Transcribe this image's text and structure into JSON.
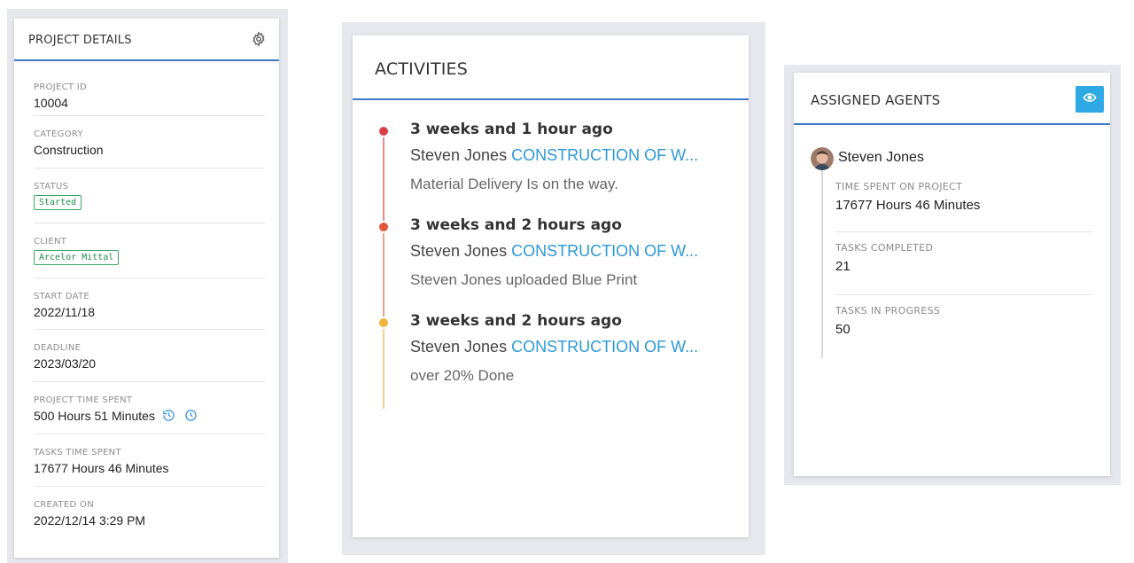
{
  "project_details": {
    "title": "PROJECT DETAILS",
    "fields": [
      {
        "label": "PROJECT ID",
        "value": "10004"
      },
      {
        "label": "CATEGORY",
        "value": "Construction"
      },
      {
        "label": "STATUS",
        "badge": "Started"
      },
      {
        "label": "CLIENT",
        "badge": "Arcelor Mittal"
      },
      {
        "label": "START DATE",
        "value": "2022/11/18"
      },
      {
        "label": "DEADLINE",
        "value": "2023/03/20"
      },
      {
        "label": "PROJECT TIME SPENT",
        "value": "500 Hours 51 Minutes"
      },
      {
        "label": "TASKS TIME SPENT",
        "value": "17677 Hours 46 Minutes"
      },
      {
        "label": "CREATED ON",
        "value": "2022/12/14 3:29 PM"
      }
    ]
  },
  "activities": {
    "title": "ACTIVITIES",
    "items": [
      {
        "time": "3 weeks and 1 hour ago",
        "user": "Steven Jones",
        "project": "CONSTRUCTION OF W...",
        "desc": "Material Delivery Is on the way.",
        "color": "#d9404a"
      },
      {
        "time": "3 weeks and 2 hours ago",
        "user": "Steven Jones",
        "project": "CONSTRUCTION OF W...",
        "desc": "Steven Jones uploaded Blue Print",
        "color": "#e2563a"
      },
      {
        "time": "3 weeks and 2 hours ago",
        "user": "Steven Jones",
        "project": "CONSTRUCTION OF W...",
        "desc": "over 20% Done",
        "color": "#f0b43c"
      }
    ]
  },
  "agents": {
    "title": "ASSIGNED AGENTS",
    "agent": {
      "name": "Steven Jones",
      "stats": [
        {
          "label": "TIME SPENT ON PROJECT",
          "value": "17677 Hours 46 Minutes"
        },
        {
          "label": "TASKS COMPLETED",
          "value": "21"
        },
        {
          "label": "TASKS IN PROGRESS",
          "value": "50"
        }
      ]
    }
  },
  "colors": {
    "accent": "#3d78c8",
    "link": "#2e98d6",
    "badge_green": "#1e8e4a",
    "eye_button": "#2ea9e6"
  }
}
